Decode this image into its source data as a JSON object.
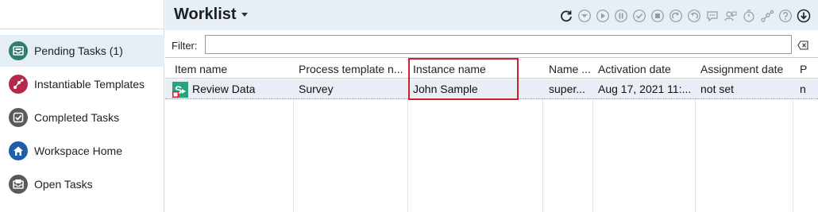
{
  "sidebar": {
    "items": [
      {
        "label": "Pending Tasks (1)",
        "icon": "inbox-icon",
        "selected": true
      },
      {
        "label": "Instantiable Templates",
        "icon": "process-icon",
        "selected": false
      },
      {
        "label": "Completed Tasks",
        "icon": "checkmark-icon",
        "selected": false
      },
      {
        "label": "Workspace Home",
        "icon": "home-icon",
        "selected": false
      },
      {
        "label": "Open Tasks",
        "icon": "open-tray-icon",
        "selected": false
      }
    ]
  },
  "header": {
    "title": "Worklist",
    "toolbar_icons": [
      "refresh-icon",
      "claim-icon",
      "start-icon",
      "pause-icon",
      "complete-icon",
      "stop-icon",
      "redo-icon",
      "undo-icon",
      "comment-icon",
      "delegate-icon",
      "timer-icon",
      "process-icon",
      "help-icon",
      "download-icon"
    ]
  },
  "filter": {
    "label": "Filter:",
    "value": "",
    "placeholder": ""
  },
  "table": {
    "columns": [
      "Item name",
      "Process template n...",
      "Instance name",
      "Name ...",
      "Activation date",
      "Assignment date",
      "P"
    ],
    "rows": [
      {
        "item_name": "Review Data",
        "process_template": "Survey",
        "instance_name": "John Sample",
        "name": "super...",
        "activation_date": "Aug 17, 2021 11:...",
        "assignment_date": "not set",
        "p": "n"
      }
    ]
  },
  "colors": {
    "accent_bg": "#e6eef6",
    "selection": "#e5edf6",
    "highlight_border": "#d0202a",
    "icon_teal": "#2e7d6e",
    "icon_magenta": "#b5284b",
    "icon_gray": "#5a5a5a",
    "icon_blue": "#1f5fa8"
  }
}
